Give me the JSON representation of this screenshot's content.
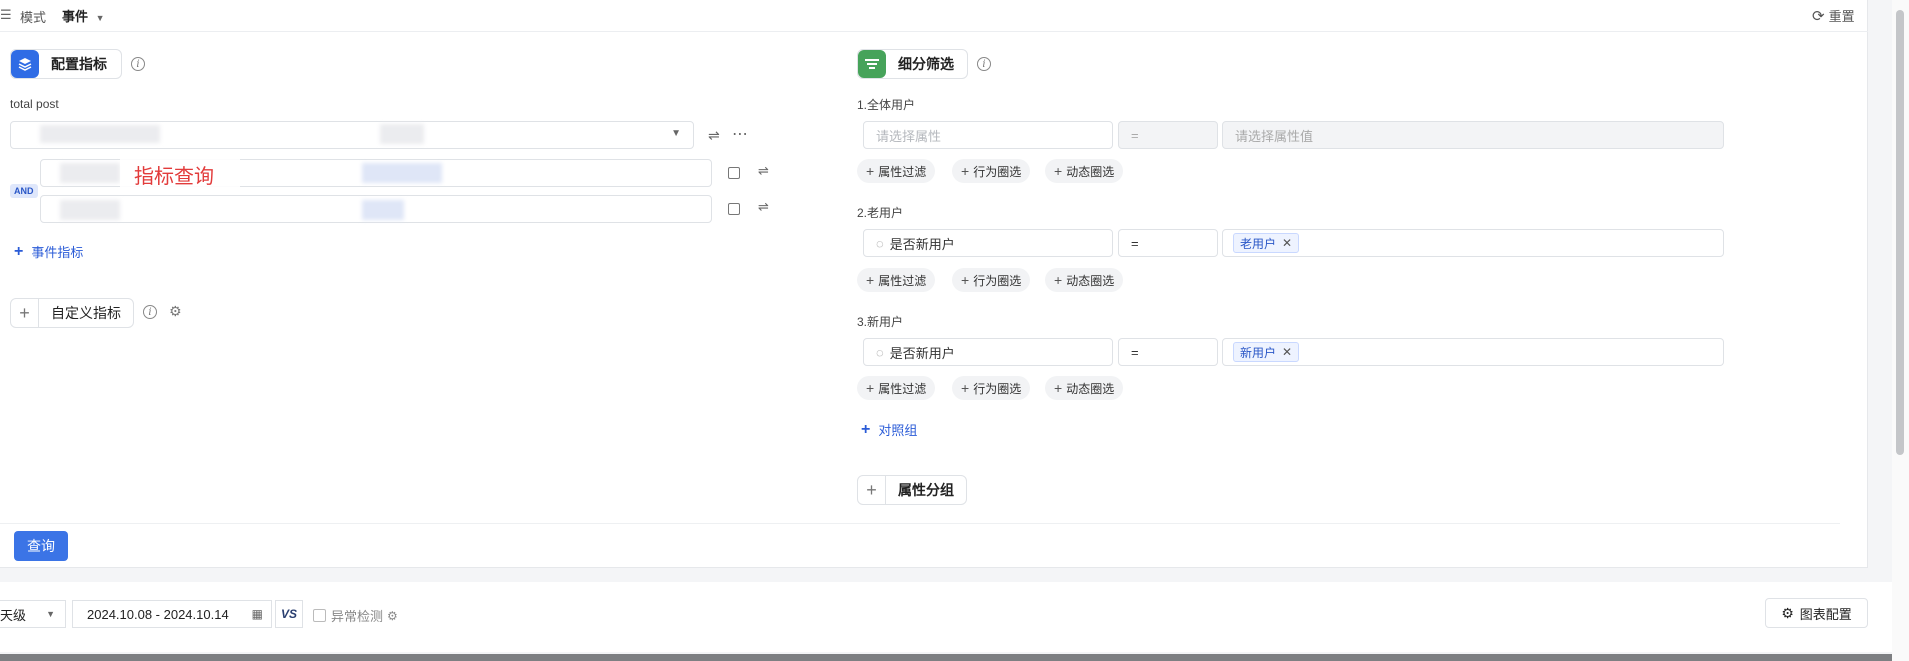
{
  "topbar": {
    "mode_label": "模式",
    "event_label": "事件",
    "reset_label": "重置"
  },
  "metrics": {
    "title": "配置指标",
    "metric_name": "total post",
    "overlay_text": "指标查询",
    "and_label": "AND",
    "add_event_metric": "事件指标",
    "custom_metric": "自定义指标"
  },
  "segments": {
    "title": "细分筛选",
    "groups": [
      {
        "label": "1.全体用户",
        "property_placeholder": "请选择属性",
        "operator": "=",
        "value_placeholder": "请选择属性值",
        "value_tag": ""
      },
      {
        "label": "2.老用户",
        "property": "是否新用户",
        "operator": "=",
        "value_tag": "老用户"
      },
      {
        "label": "3.新用户",
        "property": "是否新用户",
        "operator": "=",
        "value_tag": "新用户"
      }
    ],
    "chips": [
      "属性过滤",
      "行为圈选",
      "动态圈选"
    ],
    "add_control_group": "对照组",
    "property_group": "属性分组"
  },
  "query_button": "查询",
  "bottombar": {
    "granularity": "天级",
    "date_range": "2024.10.08 - 2024.10.14",
    "vs_label": "VS",
    "anomaly_label": "异常检测",
    "chart_config": "图表配置"
  },
  "colors": {
    "accent": "#3b74e6",
    "metric_icon": "#2f6ce5",
    "segment_icon": "#46a35a",
    "overlay_red": "#e23b3b",
    "tag_blue": "#2a57c7"
  }
}
